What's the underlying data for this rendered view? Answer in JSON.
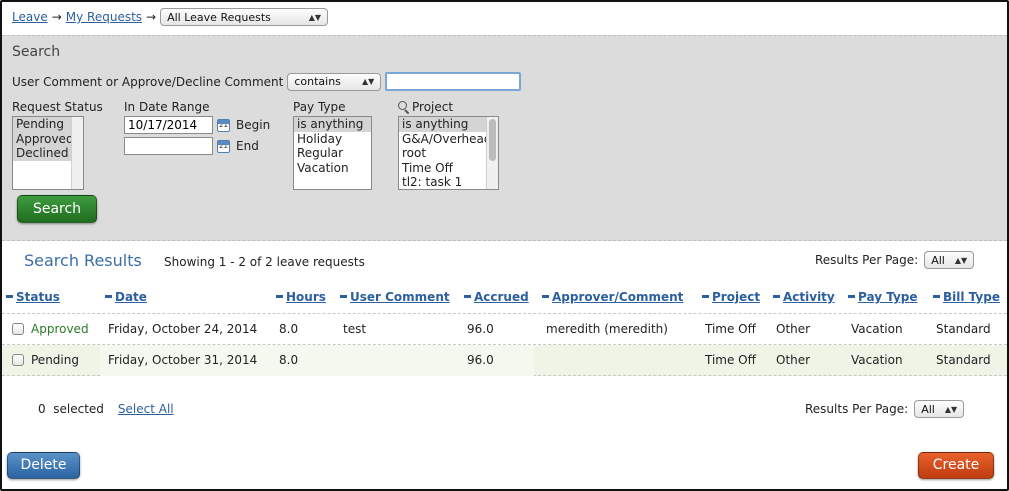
{
  "breadcrumb": {
    "leave": "Leave",
    "my_requests": "My Requests",
    "separator": "→",
    "view_select": "All Leave Requests"
  },
  "search": {
    "title": "Search",
    "comment_label": "User Comment or Approve/Decline Comment",
    "comment_operator": "contains",
    "comment_value": "",
    "request_status": {
      "label": "Request Status",
      "options": [
        "Pending",
        "Approved",
        "Declined"
      ]
    },
    "date_range": {
      "label": "In Date Range",
      "begin_value": "10/17/2014",
      "begin_label": "Begin",
      "end_value": "",
      "end_label": "End"
    },
    "pay_type": {
      "label": "Pay Type",
      "options": [
        "is anything",
        "Holiday",
        "Regular",
        "Vacation"
      ],
      "selected": "is anything"
    },
    "project": {
      "label": "Project",
      "options": [
        "is anything",
        "G&A/Overhead",
        "root",
        "Time Off",
        "tl2: task 1"
      ],
      "selected": "is anything"
    },
    "button": "Search"
  },
  "results": {
    "title": "Search Results",
    "showing": "Showing 1 - 2 of 2 leave requests",
    "per_page_label": "Results Per Page:",
    "per_page_value": "All",
    "columns": [
      "Status",
      "Date",
      "Hours",
      "User Comment",
      "Accrued",
      "Approver/Comment",
      "Project",
      "Activity",
      "Pay Type",
      "Bill Type"
    ],
    "rows": [
      {
        "status": "Approved",
        "date": "Friday, October 24, 2014",
        "hours": "8.0",
        "user_comment": "test",
        "accrued": "96.0",
        "approver": "meredith (meredith)",
        "project": "Time Off",
        "activity": "Other",
        "pay_type": "Vacation",
        "bill_type": "Standard"
      },
      {
        "status": "Pending",
        "date": "Friday, October 31, 2014",
        "hours": "8.0",
        "user_comment": "",
        "accrued": "96.0",
        "approver": "",
        "project": "Time Off",
        "activity": "Other",
        "pay_type": "Vacation",
        "bill_type": "Standard"
      }
    ]
  },
  "footer": {
    "selected": "0  selected",
    "select_all": "Select All",
    "delete": "Delete",
    "create": "Create"
  },
  "colors": {
    "link": "#2c5f9e",
    "search_button": "#2f862f",
    "delete_button": "#3a75b3",
    "create_button": "#d44a1a",
    "approved_status": "#2a7a2a"
  },
  "icons": {
    "calendar": "calendar-icon",
    "magnifier": "magnifier-icon",
    "caret": "select-caret-icon"
  }
}
